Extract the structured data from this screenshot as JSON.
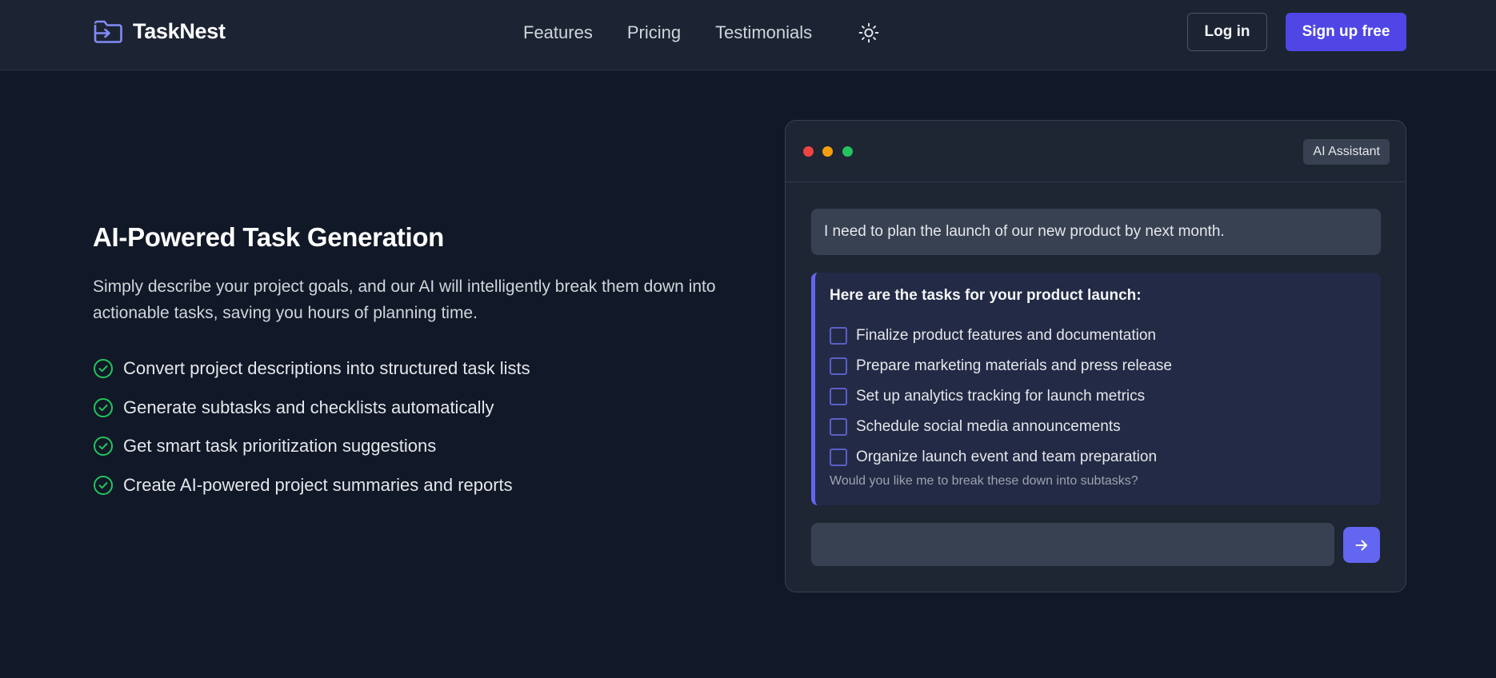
{
  "header": {
    "brand": "TaskNest",
    "nav": [
      "Features",
      "Pricing",
      "Testimonials"
    ],
    "login_label": "Log in",
    "signup_label": "Sign up free",
    "theme_icon": "sun-icon"
  },
  "hero": {
    "title": "AI-Powered Task Generation",
    "description": "Simply describe your project goals, and our AI will intelligently break them down into actionable tasks, saving you hours of planning time.",
    "features": [
      "Convert project descriptions into structured task lists",
      "Generate subtasks and checklists automatically",
      "Get smart task prioritization suggestions",
      "Create AI-powered project summaries and reports"
    ]
  },
  "chat": {
    "badge": "AI Assistant",
    "user_message": "I need to plan the launch of our new product by next month.",
    "ai_heading": "Here are the tasks for your product launch:",
    "tasks": [
      "Finalize product features and documentation",
      "Prepare marketing materials and press release",
      "Set up analytics tracking for launch metrics",
      "Schedule social media announcements",
      "Organize launch event and team preparation"
    ],
    "ai_footnote": "Would you like me to break these down into subtasks?",
    "input_value": "",
    "input_placeholder": ""
  },
  "colors": {
    "background": "#111827",
    "header": "#1c2433",
    "accent": "#4f46e5",
    "accent_light": "#6366f1",
    "success": "#22c55e"
  }
}
